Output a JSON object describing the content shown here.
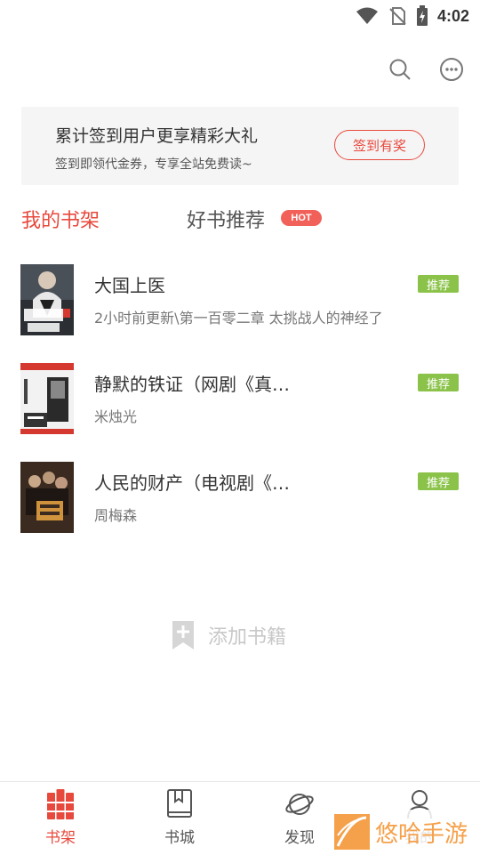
{
  "status_bar": {
    "time": "4:02"
  },
  "top_actions": {
    "search_icon": "search-icon",
    "more_icon": "more-icon"
  },
  "banner": {
    "title": "累计签到用户更享精彩大礼",
    "subtitle": "签到即领代金券，专享全站免费读~",
    "button": "签到有奖"
  },
  "tabs": {
    "mine": "我的书架",
    "recommend": "好书推荐",
    "hot_badge": "HOT"
  },
  "books": [
    {
      "title": "大国上医",
      "meta": "2小时前更新\\第一百零二章 太挑战人的神经了",
      "tag": "推荐"
    },
    {
      "title": "静默的铁证（网剧《真…",
      "meta": "米烛光",
      "tag": "推荐"
    },
    {
      "title": "人民的财产（电视剧《…",
      "meta": "周梅森",
      "tag": "推荐"
    }
  ],
  "add_books": {
    "label": "添加书籍"
  },
  "bottom_nav": [
    {
      "label": "书架",
      "active": true
    },
    {
      "label": "书城",
      "active": false
    },
    {
      "label": "发现",
      "active": false
    },
    {
      "label": "我的",
      "active": false
    }
  ],
  "watermark": {
    "text": "悠哈手游"
  },
  "colors": {
    "accent": "#e8493d",
    "tag_green": "#8bc34a",
    "hot_red": "#f2605a"
  }
}
